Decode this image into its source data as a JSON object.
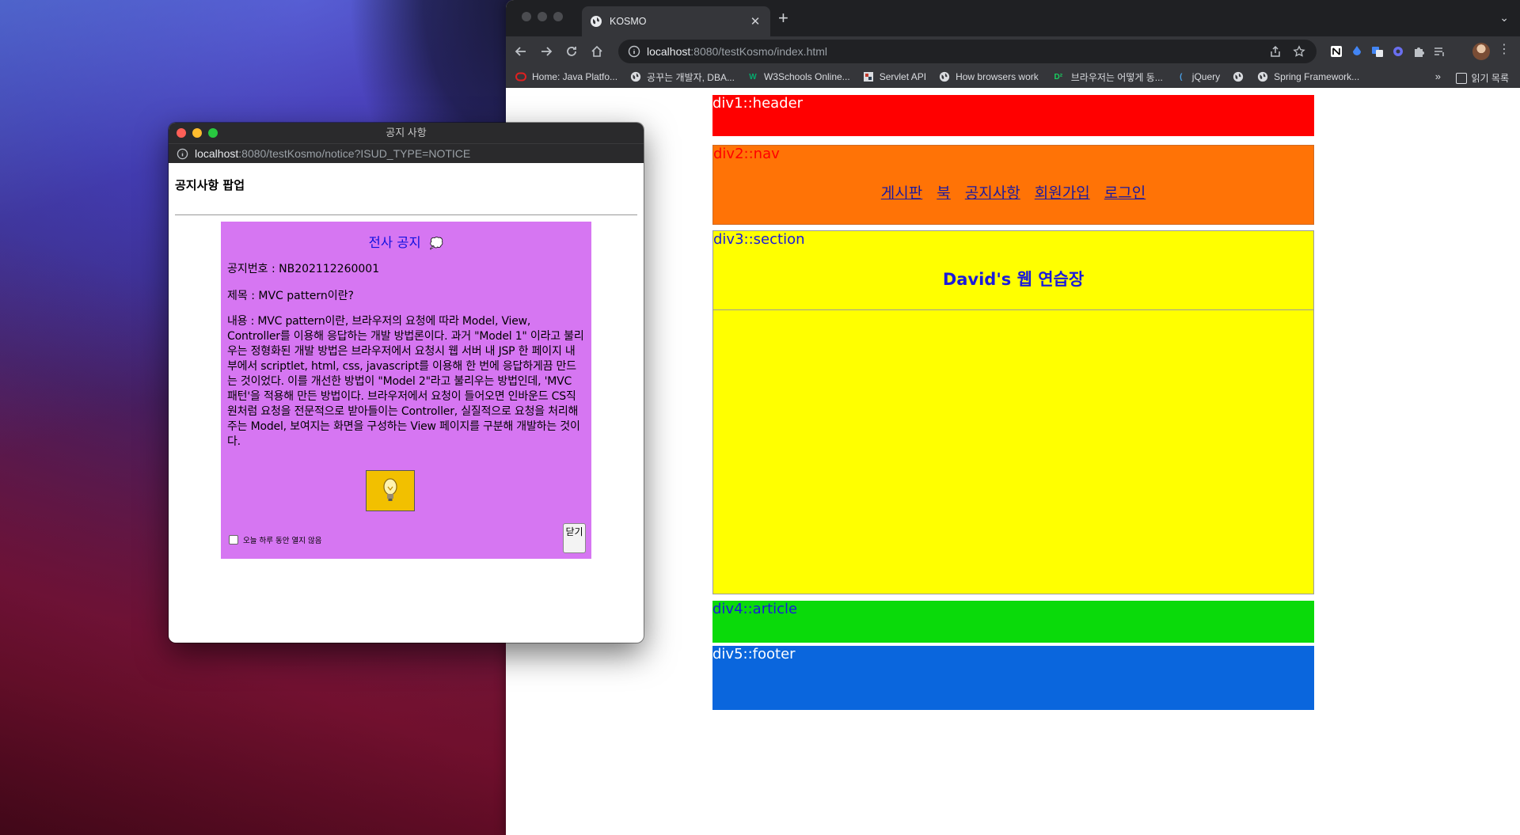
{
  "browser": {
    "tab_title": "KOSMO",
    "url_host": "localhost",
    "url_rest": ":8080/testKosmo/index.html",
    "bookmarks": [
      {
        "label": "Home: Java Platfo...",
        "icon": "oracle-icon"
      },
      {
        "label": "공꾸는 개발자, DBA...",
        "icon": "globe-icon"
      },
      {
        "label": "W3Schools Online...",
        "icon": "w3schools-icon"
      },
      {
        "label": "Servlet API",
        "icon": "servlet-icon"
      },
      {
        "label": "How browsers work",
        "icon": "globe-icon"
      },
      {
        "label": "브라우저는 어떻게 동...",
        "icon": "d2-icon"
      },
      {
        "label": "jQuery",
        "icon": "jquery-icon"
      },
      {
        "label": "",
        "icon": "globe-icon"
      },
      {
        "label": "Spring Framework...",
        "icon": "globe-icon"
      }
    ],
    "reading_list": "읽기 목록"
  },
  "page": {
    "header_label": "div1::header",
    "nav_label": "div2::nav",
    "nav_links": [
      "게시판",
      "북",
      "공지사항",
      "회원가입",
      "로그인"
    ],
    "section_label": "div3::section",
    "section_heading": "David's 웹 연습장",
    "article_label": "div4::article",
    "footer_label": "div5::footer",
    "colors": {
      "header": "#ff0000",
      "nav": "#ff7306",
      "section": "#ffff00",
      "article": "#0ada0a",
      "footer": "#0a66dd"
    }
  },
  "popup": {
    "window_title": "공지 사항",
    "url_host": "localhost",
    "url_rest": ":8080/testKosmo/notice?ISUD_TYPE=NOTICE",
    "heading": "공지사항 팝업",
    "notice": {
      "title": "전사 공지",
      "number": "공지번호 : NB202112260001",
      "subject": "제목 : MVC pattern이란?",
      "content": "내용 : MVC pattern이란, 브라우저의 요청에 따라 Model, View, Controller를 이용해 응답하는 개발 방법론이다. 과거 \"Model 1\" 이라고 불리우는 정형화된 개발 방법은 브라우저에서 요청시 웹 서버 내 JSP 한 페이지 내부에서 scriptlet, html, css, javascript를 이용해 한 번에 응답하게끔 만드는 것이었다. 이를 개선한 방법이 \"Model 2\"라고 불리우는 방법인데, 'MVC 패턴'을 적용해 만든 방법이다. 브라우저에서 요청이 들어오면 인바운드 CS직원처럼 요청을 전문적으로 받아들이는 Controller, 실질적으로 요청을 처리해주는 Model, 보여지는 화면을 구성하는 View 페이지를 구분해 개발하는 것이다.",
      "checkbox_label": "오늘 하루 동안 열지 않음",
      "close_label": "닫기"
    }
  }
}
